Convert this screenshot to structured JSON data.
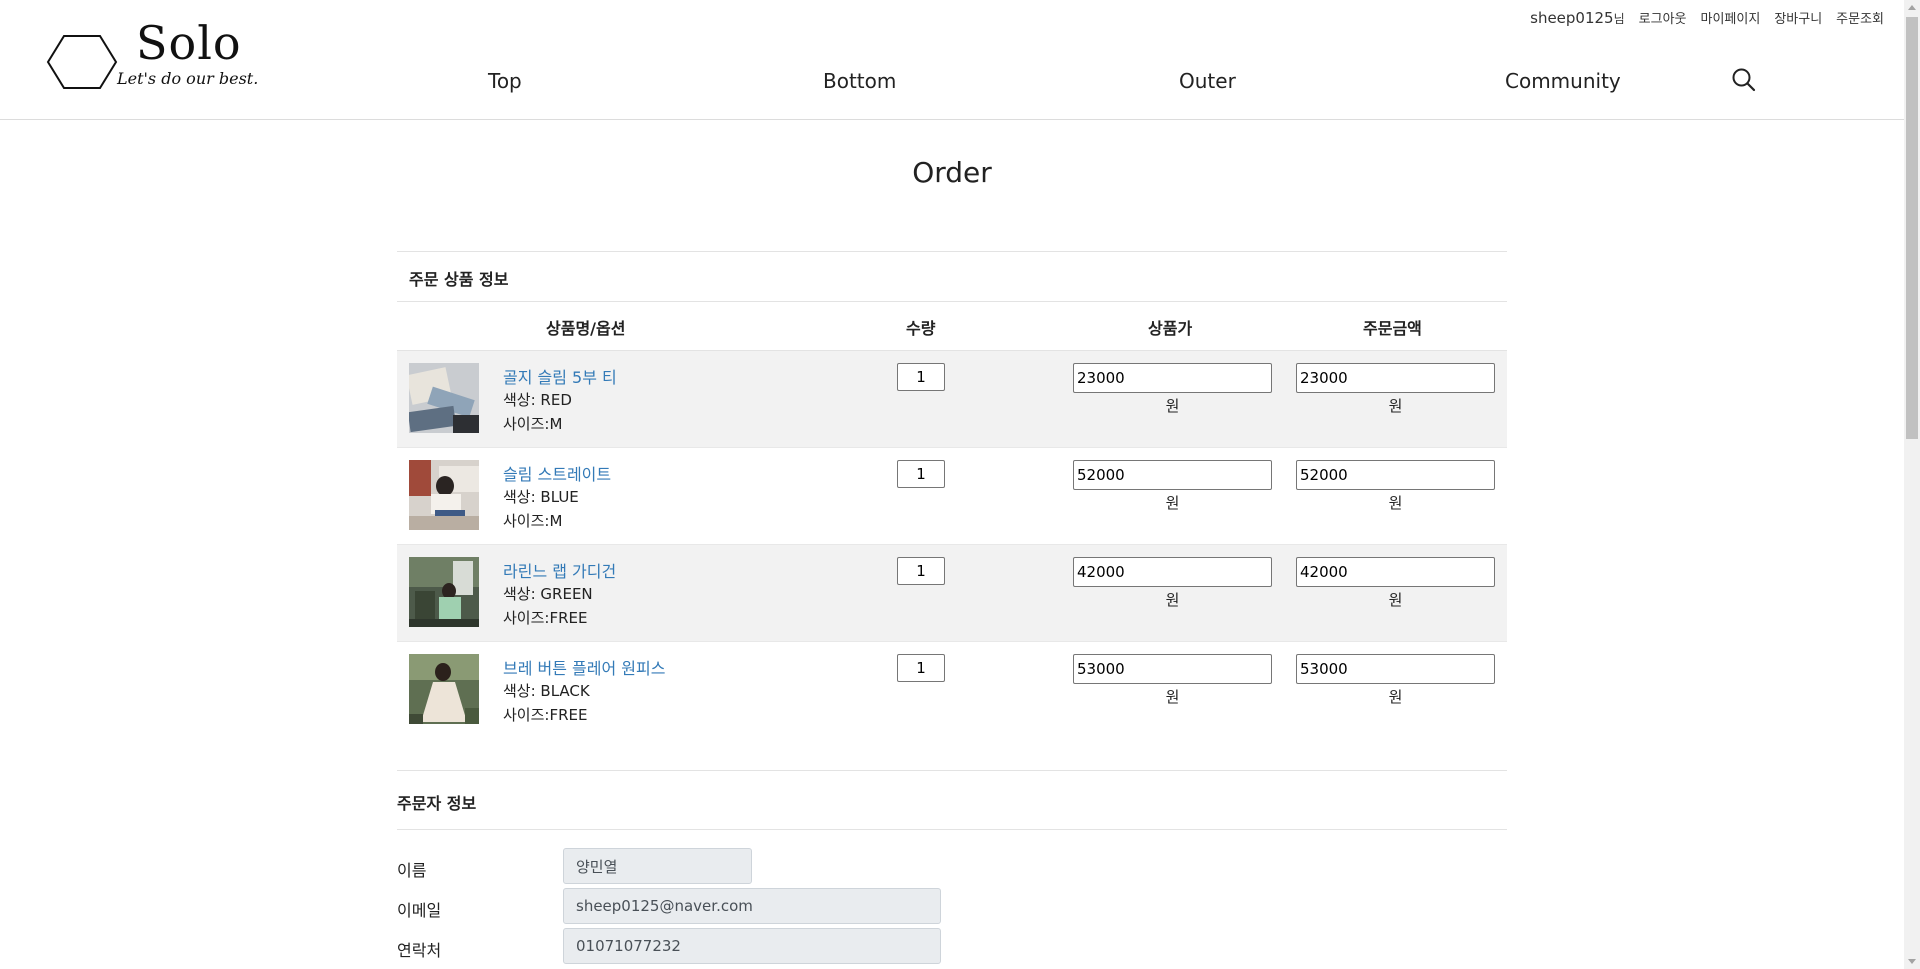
{
  "header": {
    "logo_title": "Solo",
    "logo_subtitle": "Let's do our best.",
    "user_name": "sheep0125",
    "user_suffix": "님",
    "util_links": [
      "로그아웃",
      "마이페이지",
      "장바구니",
      "주문조회"
    ],
    "nav": [
      "Top",
      "Bottom",
      "Outer",
      "Community"
    ],
    "search_icon": "search-icon"
  },
  "page_title": "Order",
  "order_items_section": {
    "title": "주문 상품 정보",
    "columns": [
      "상품명/옵션",
      "수량",
      "상품가",
      "주문금액"
    ],
    "currency_unit": "원",
    "items": [
      {
        "name": "골지 슬림 5부 티",
        "color": "색상: RED",
        "size": "사이즈:M",
        "qty": "1",
        "price": "23000",
        "total": "23000"
      },
      {
        "name": "슬림 스트레이트",
        "color": "색상: BLUE",
        "size": "사이즈:M",
        "qty": "1",
        "price": "52000",
        "total": "52000"
      },
      {
        "name": "라린느 랩 가디건",
        "color": "색상: GREEN",
        "size": "사이즈:FREE",
        "qty": "1",
        "price": "42000",
        "total": "42000"
      },
      {
        "name": "브레 버튼 플레어 원피스",
        "color": "색상: BLACK",
        "size": "사이즈:FREE",
        "qty": "1",
        "price": "53000",
        "total": "53000"
      }
    ]
  },
  "orderer_section": {
    "title": "주문자 정보",
    "fields": [
      {
        "label": "이름",
        "value": "양민열"
      },
      {
        "label": "이메일",
        "value": "sheep0125@naver.com"
      },
      {
        "label": "연락처",
        "value": "01071077232"
      }
    ]
  },
  "colors": {
    "link": "#337ab7",
    "row_shade": "#f2f2f2",
    "readonly_bg": "#e9ecef"
  }
}
